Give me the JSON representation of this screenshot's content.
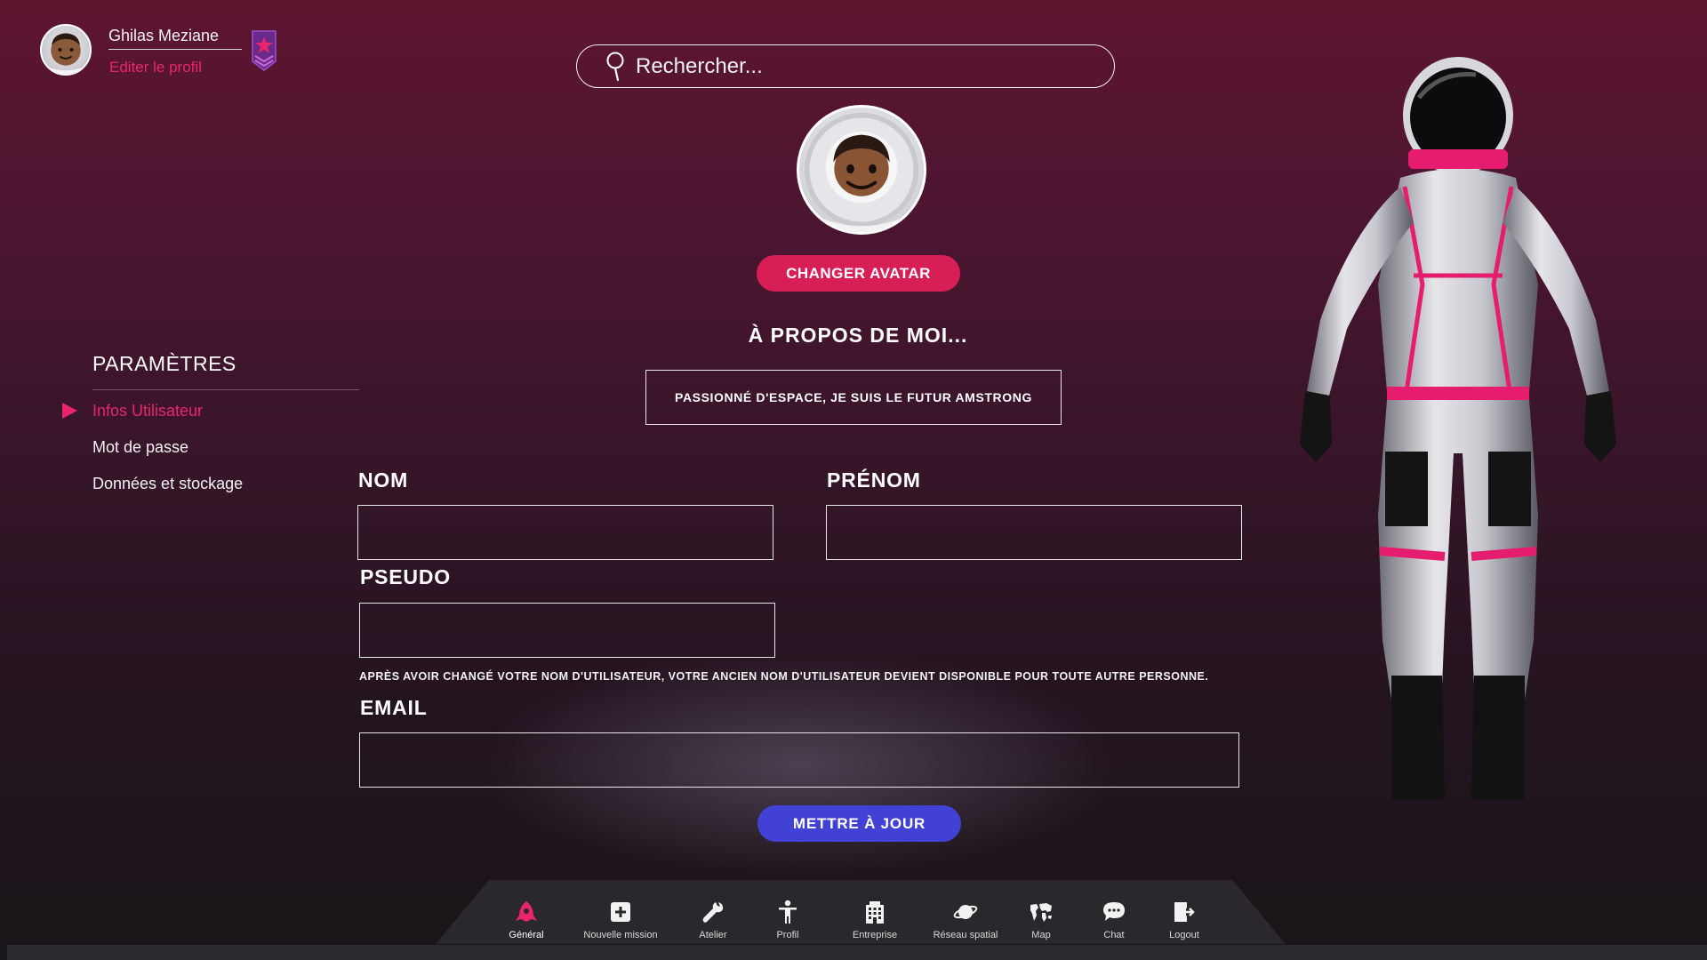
{
  "profile": {
    "name": "Ghilas Meziane",
    "edit_label": "Editer le profil"
  },
  "search": {
    "placeholder": "Rechercher..."
  },
  "avatar": {
    "change_label": "CHANGER AVATAR"
  },
  "about": {
    "title": "À PROPOS DE MOI...",
    "bio": "PASSIONNÉ D'ESPACE, JE SUIS LE FUTUR AMSTRONG"
  },
  "settings": {
    "title": "PARAMÈTRES",
    "items": [
      {
        "label": "Infos Utilisateur",
        "active": true
      },
      {
        "label": "Mot de passe",
        "active": false
      },
      {
        "label": "Données et stockage",
        "active": false
      }
    ]
  },
  "form": {
    "nom_label": "NOM",
    "nom_value": "",
    "prenom_label": "PRÉNOM",
    "prenom_value": "",
    "pseudo_label": "PSEUDO",
    "pseudo_value": "",
    "pseudo_notice": "APRÈS AVOIR CHANGÉ VOTRE NOM D'UTILISATEUR, VOTRE ANCIEN NOM D'UTILISATEUR DEVIENT DISPONIBLE POUR TOUTE AUTRE PERSONNE.",
    "email_label": "EMAIL",
    "email_value": "",
    "submit_label": "METTRE À JOUR"
  },
  "nav": {
    "items": [
      {
        "label": "Général",
        "icon": "rocket-icon",
        "active": true
      },
      {
        "label": "Nouvelle mission",
        "icon": "plus-square-icon",
        "active": false
      },
      {
        "label": "Atelier",
        "icon": "wrench-icon",
        "active": false
      },
      {
        "label": "Profil",
        "icon": "person-icon",
        "active": false
      },
      {
        "label": "Entreprise",
        "icon": "building-icon",
        "active": false
      },
      {
        "label": "Réseau spatial",
        "icon": "planet-icon",
        "active": false
      },
      {
        "label": "Map",
        "icon": "world-map-icon",
        "active": false
      },
      {
        "label": "Chat",
        "icon": "chat-bubble-icon",
        "active": false
      },
      {
        "label": "Logout",
        "icon": "logout-icon",
        "active": false
      }
    ]
  },
  "colors": {
    "accent_pink": "#e8256a",
    "button_pink": "#d81f55",
    "button_blue": "#4141d6",
    "background_top": "#5e1530",
    "background_bottom": "#1a1519"
  }
}
